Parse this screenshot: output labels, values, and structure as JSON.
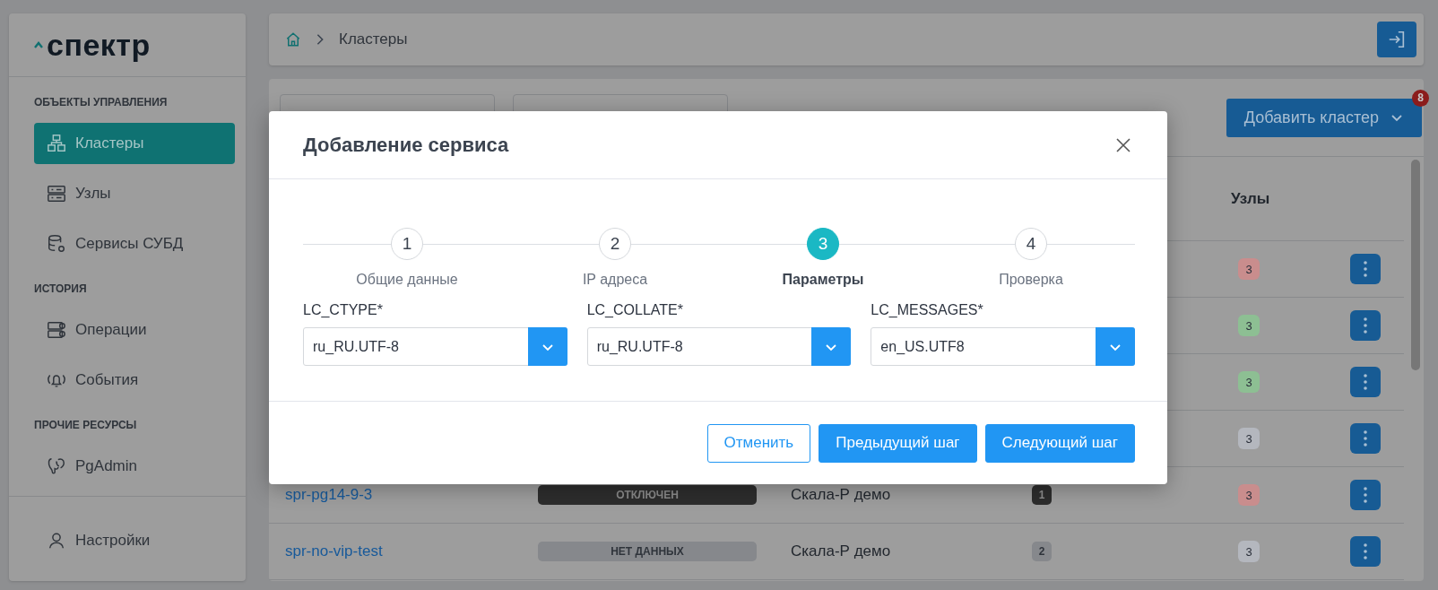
{
  "sidebar": {
    "logo": "спектр",
    "sections": [
      {
        "title": "ОБЪЕКТЫ УПРАВЛЕНИЯ",
        "items": [
          {
            "label": "Кластеры",
            "selected": true
          },
          {
            "label": "Узлы",
            "selected": false
          },
          {
            "label": "Сервисы СУБД",
            "selected": false
          }
        ]
      },
      {
        "title": "ИСТОРИЯ",
        "items": [
          {
            "label": "Операции",
            "selected": false
          },
          {
            "label": "События",
            "selected": false
          }
        ]
      },
      {
        "title": "ПРОЧИЕ РЕСУРСЫ",
        "items": [
          {
            "label": "PgAdmin",
            "selected": false
          }
        ]
      }
    ],
    "footer_item": {
      "label": "Настройки",
      "selected": false
    }
  },
  "breadcrumb": {
    "current": "Кластеры"
  },
  "toolbar": {
    "add_button": "Добавить кластер",
    "notification_count": "8"
  },
  "table": {
    "columns": {
      "column_5": "Узлы"
    },
    "rows": [
      {
        "nodes": {
          "text": "3",
          "color": "#c98d8d"
        }
      },
      {
        "nodes": {
          "text": "3",
          "color": "#8dbf93"
        }
      },
      {
        "nodes": {
          "text": "3",
          "color": "#8dbf93"
        }
      },
      {
        "nodes": {
          "text": "3",
          "color": "#b4b7be"
        }
      },
      {
        "name": "spr-pg14-9-3",
        "status": {
          "text": "ОТКЛЮЧЕН",
          "kind": "off"
        },
        "platform": "Скала-Р демо",
        "count": {
          "text": "1",
          "kind": "dark"
        },
        "nodes": {
          "text": "3",
          "color": "#c98d8d"
        }
      },
      {
        "name": "spr-no-vip-test",
        "status": {
          "text": "НЕТ ДАННЫХ",
          "kind": "none"
        },
        "platform": "Скала-Р демо",
        "count": {
          "text": "2",
          "kind": "light"
        },
        "nodes": {
          "text": "3",
          "color": "#b4b7be"
        }
      }
    ]
  },
  "dialog": {
    "title": "Добавление сервиса",
    "steps": [
      {
        "number": "1",
        "label": "Общие данные",
        "selected": false
      },
      {
        "number": "2",
        "label": "IP адреса",
        "selected": false
      },
      {
        "number": "3",
        "label": "Параметры",
        "selected": true
      },
      {
        "number": "4",
        "label": "Проверка",
        "selected": false
      }
    ],
    "fields": [
      {
        "label": "LC_CTYPE*",
        "value": "ru_RU.UTF-8"
      },
      {
        "label": "LC_COLLATE*",
        "value": "ru_RU.UTF-8"
      },
      {
        "label": "LC_MESSAGES*",
        "value": "en_US.UTF8"
      }
    ],
    "buttons": {
      "cancel": "Отменить",
      "previous": "Предыдущий шаг",
      "next": "Следующий шаг"
    }
  }
}
